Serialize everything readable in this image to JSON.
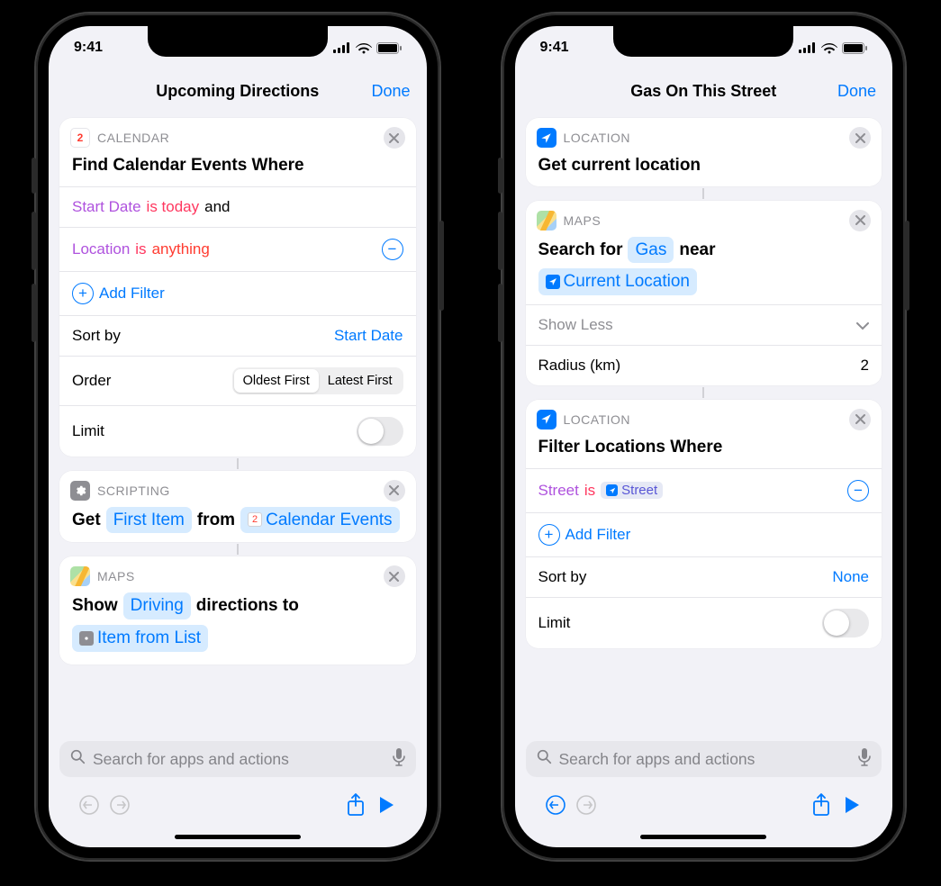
{
  "status": {
    "time": "9:41"
  },
  "leftPhone": {
    "nav": {
      "title": "Upcoming Directions",
      "done": "Done"
    },
    "card1": {
      "app": "CALENDAR",
      "title": "Find Calendar Events Where",
      "f1_field": "Start Date",
      "f1_op": "is today",
      "f1_conj": "and",
      "f2_field": "Location",
      "f2_op": "is",
      "f2_val": "anything",
      "addFilter": "Add Filter",
      "sortLabel": "Sort by",
      "sortValue": "Start Date",
      "orderLabel": "Order",
      "orderA": "Oldest First",
      "orderB": "Latest First",
      "limitLabel": "Limit"
    },
    "card2": {
      "app": "SCRIPTING",
      "pre": "Get",
      "token1": "First Item",
      "mid": "from",
      "token2": "Calendar Events"
    },
    "card3": {
      "app": "MAPS",
      "pre": "Show",
      "token1": "Driving",
      "mid": "directions to",
      "token2": "Item from List"
    }
  },
  "rightPhone": {
    "nav": {
      "title": "Gas On This Street",
      "done": "Done"
    },
    "card1": {
      "app": "LOCATION",
      "title": "Get current location"
    },
    "card2": {
      "app": "MAPS",
      "pre": "Search for",
      "token1": "Gas",
      "mid": "near",
      "token2": "Current Location",
      "showLess": "Show Less",
      "radiusLabel": "Radius (km)",
      "radiusValue": "2"
    },
    "card3": {
      "app": "LOCATION",
      "title": "Filter Locations Where",
      "f_field": "Street",
      "f_op": "is",
      "f_val": "Street",
      "addFilter": "Add Filter",
      "sortLabel": "Sort by",
      "sortValue": "None",
      "limitLabel": "Limit"
    }
  },
  "search": {
    "placeholder": "Search for apps and actions"
  }
}
